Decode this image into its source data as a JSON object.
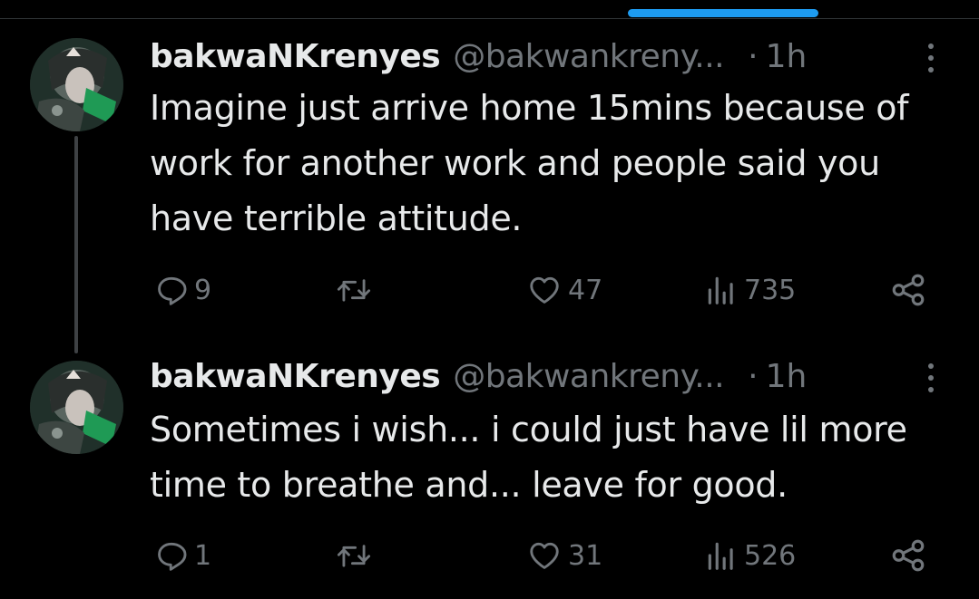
{
  "tweets": [
    {
      "display_name": "bakwaNKrenyes",
      "handle": "@bakwankreny...",
      "separator": "·",
      "time": "1h",
      "text": "Imagine just arrive home 15mins because of work for another work and people said you have terrible attitude.",
      "replies": "9",
      "retweets": "",
      "likes": "47",
      "views": "735"
    },
    {
      "display_name": "bakwaNKrenyes",
      "handle": "@bakwankreny...",
      "separator": "·",
      "time": "1h",
      "text": "Sometimes i wish... i could just have lil more time to breathe and... leave for good.",
      "replies": "1",
      "retweets": "",
      "likes": "31",
      "views": "526"
    }
  ],
  "icons": {
    "reply": "reply-icon",
    "retweet": "retweet-icon",
    "like": "heart-icon",
    "views": "views-icon",
    "share": "share-icon",
    "more": "more-icon"
  },
  "colors": {
    "background": "#000000",
    "text_primary": "#e7e9ea",
    "text_secondary": "#71767b",
    "accent": "#1d9bf0",
    "thread_line": "#3e4144"
  }
}
